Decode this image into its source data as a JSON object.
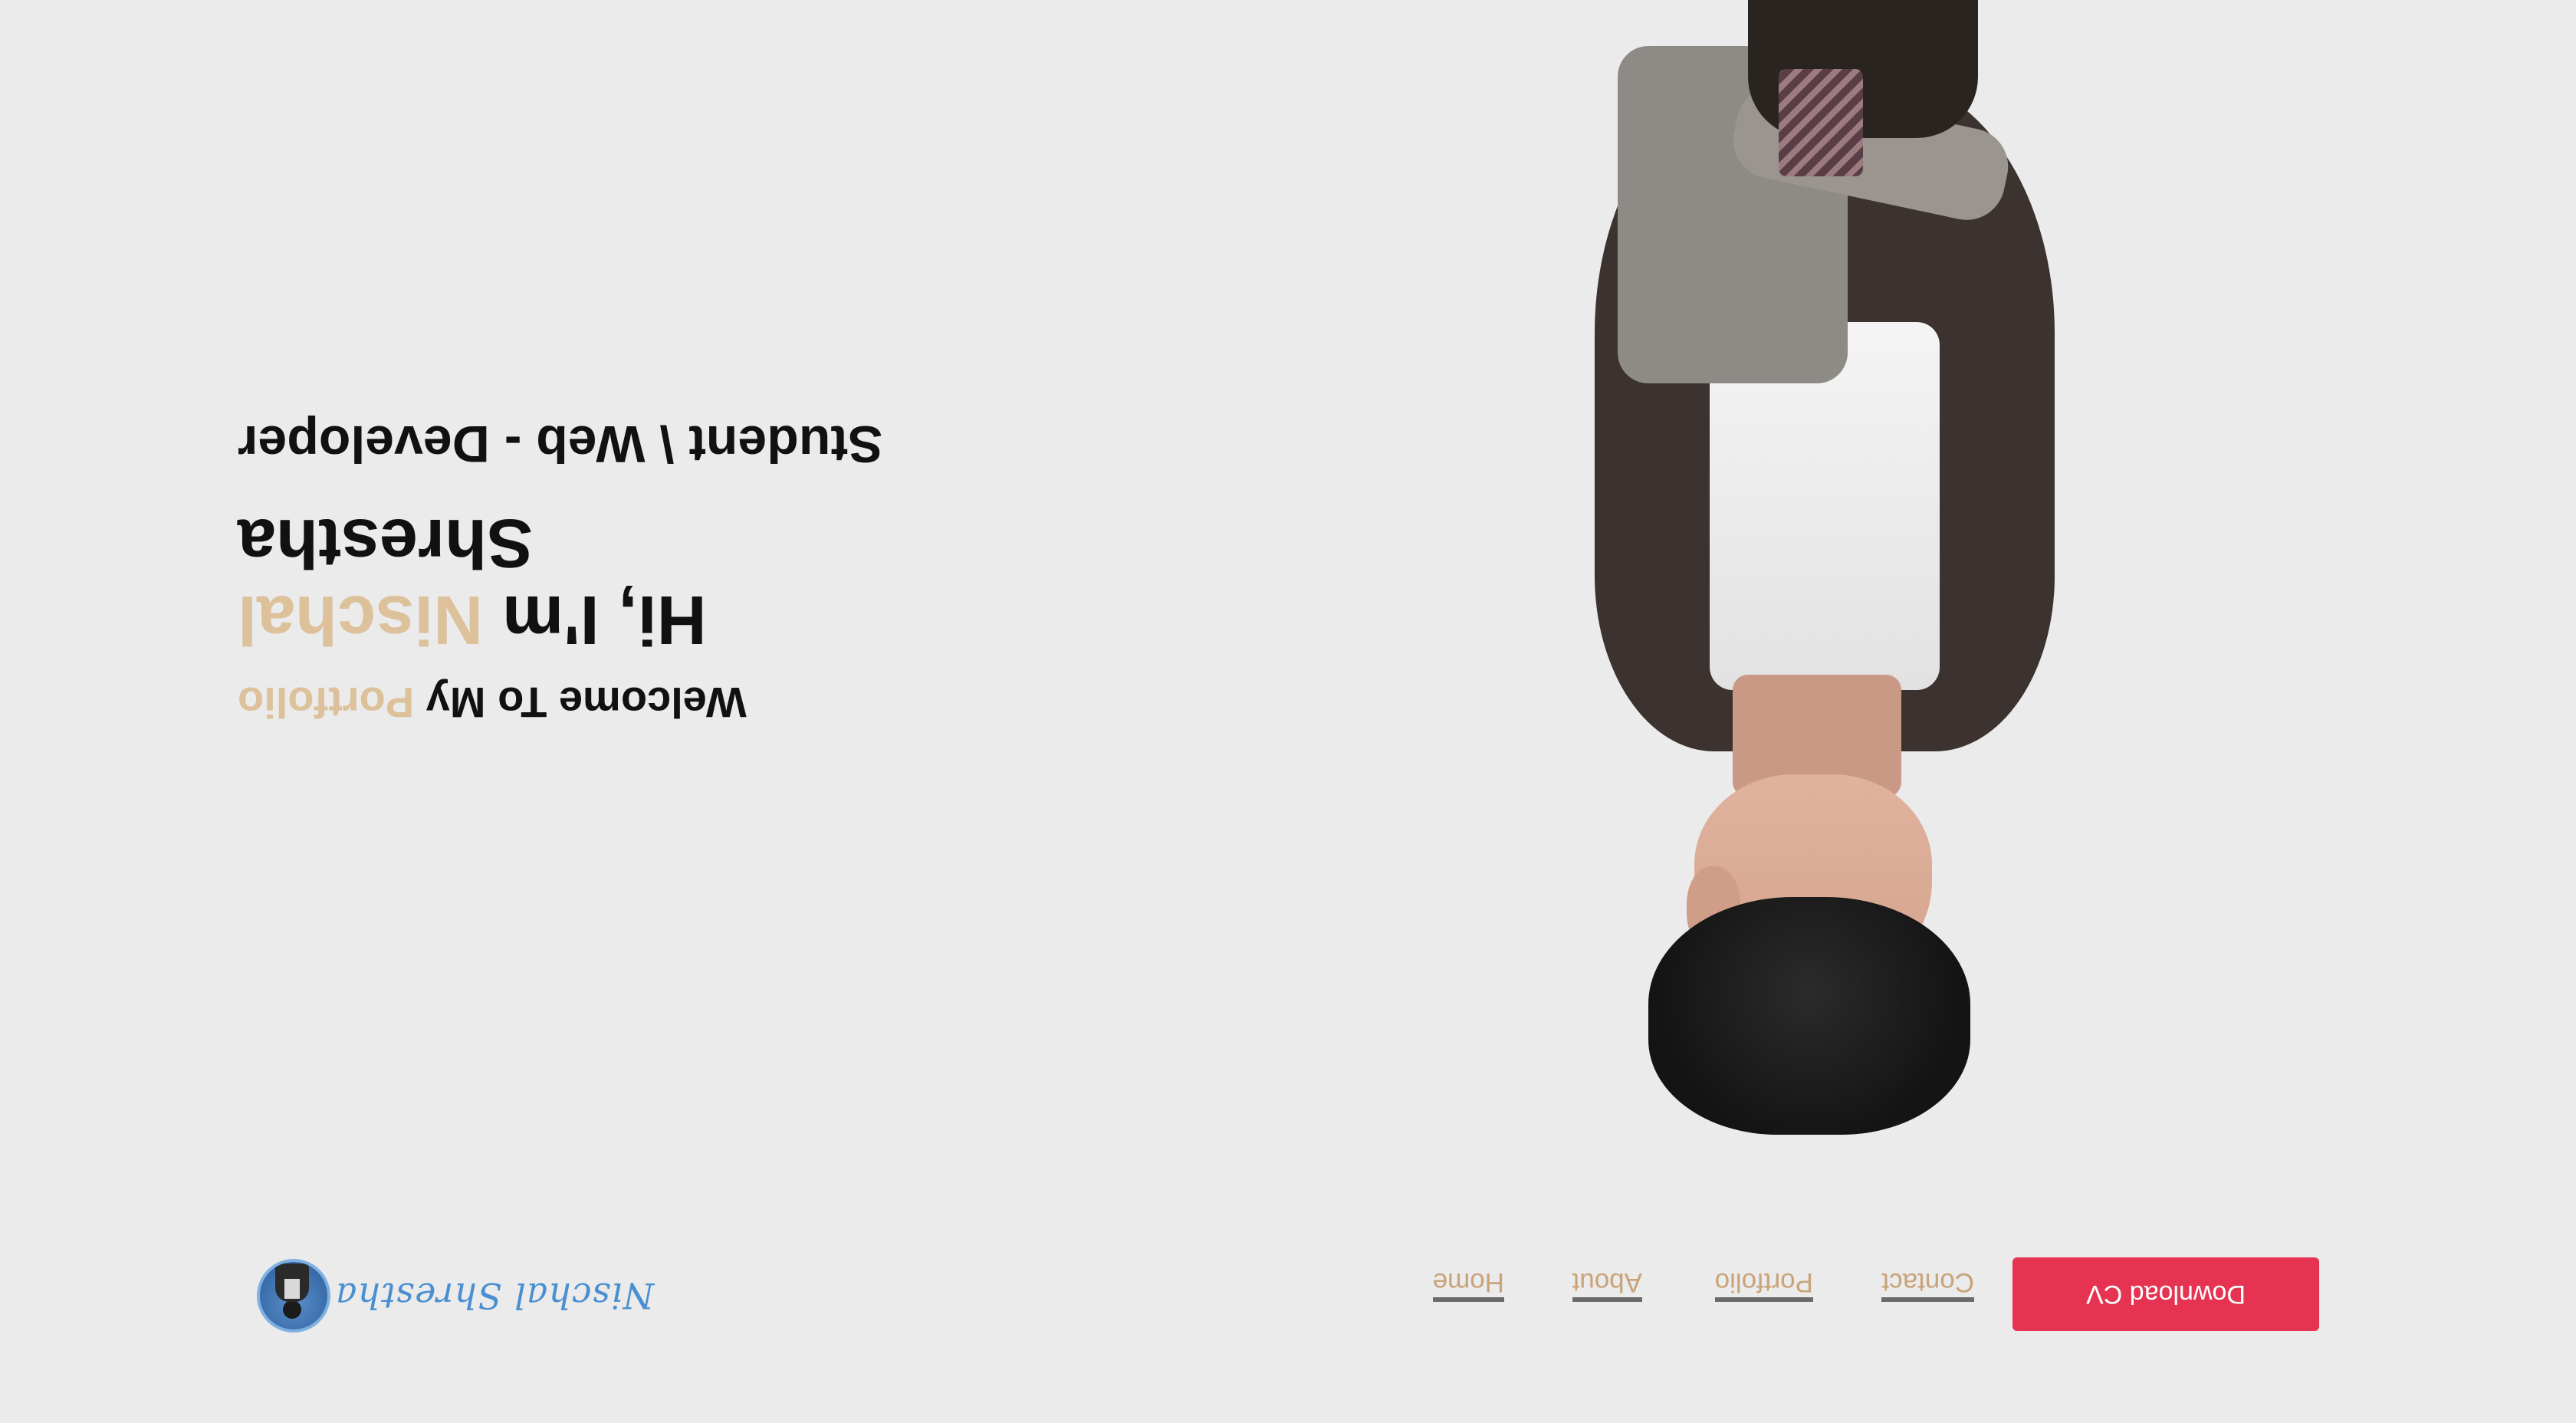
{
  "brand": {
    "name": "Nischal Shrestha",
    "logo_icon": "avatar-photo-icon",
    "color": "#4a8fd1"
  },
  "nav": {
    "items": [
      "Home",
      "About",
      "Portfolio",
      "Contact"
    ],
    "link_color": "#c9a37a"
  },
  "cta": {
    "label": "Download CV",
    "color": "#e63352"
  },
  "hero": {
    "welcome": "Welcome To My",
    "welcome_accent": "Portfolio",
    "greeting": "Hi, I'm",
    "first_name": "Nischal",
    "last_name": "Shrestha",
    "role": "Student \\ Web - Developer",
    "accent_color": "#dcc19a"
  },
  "photo": {
    "icon": "portrait-photo-icon"
  },
  "colors": {
    "background": "#ebebeb",
    "text": "#111111"
  }
}
